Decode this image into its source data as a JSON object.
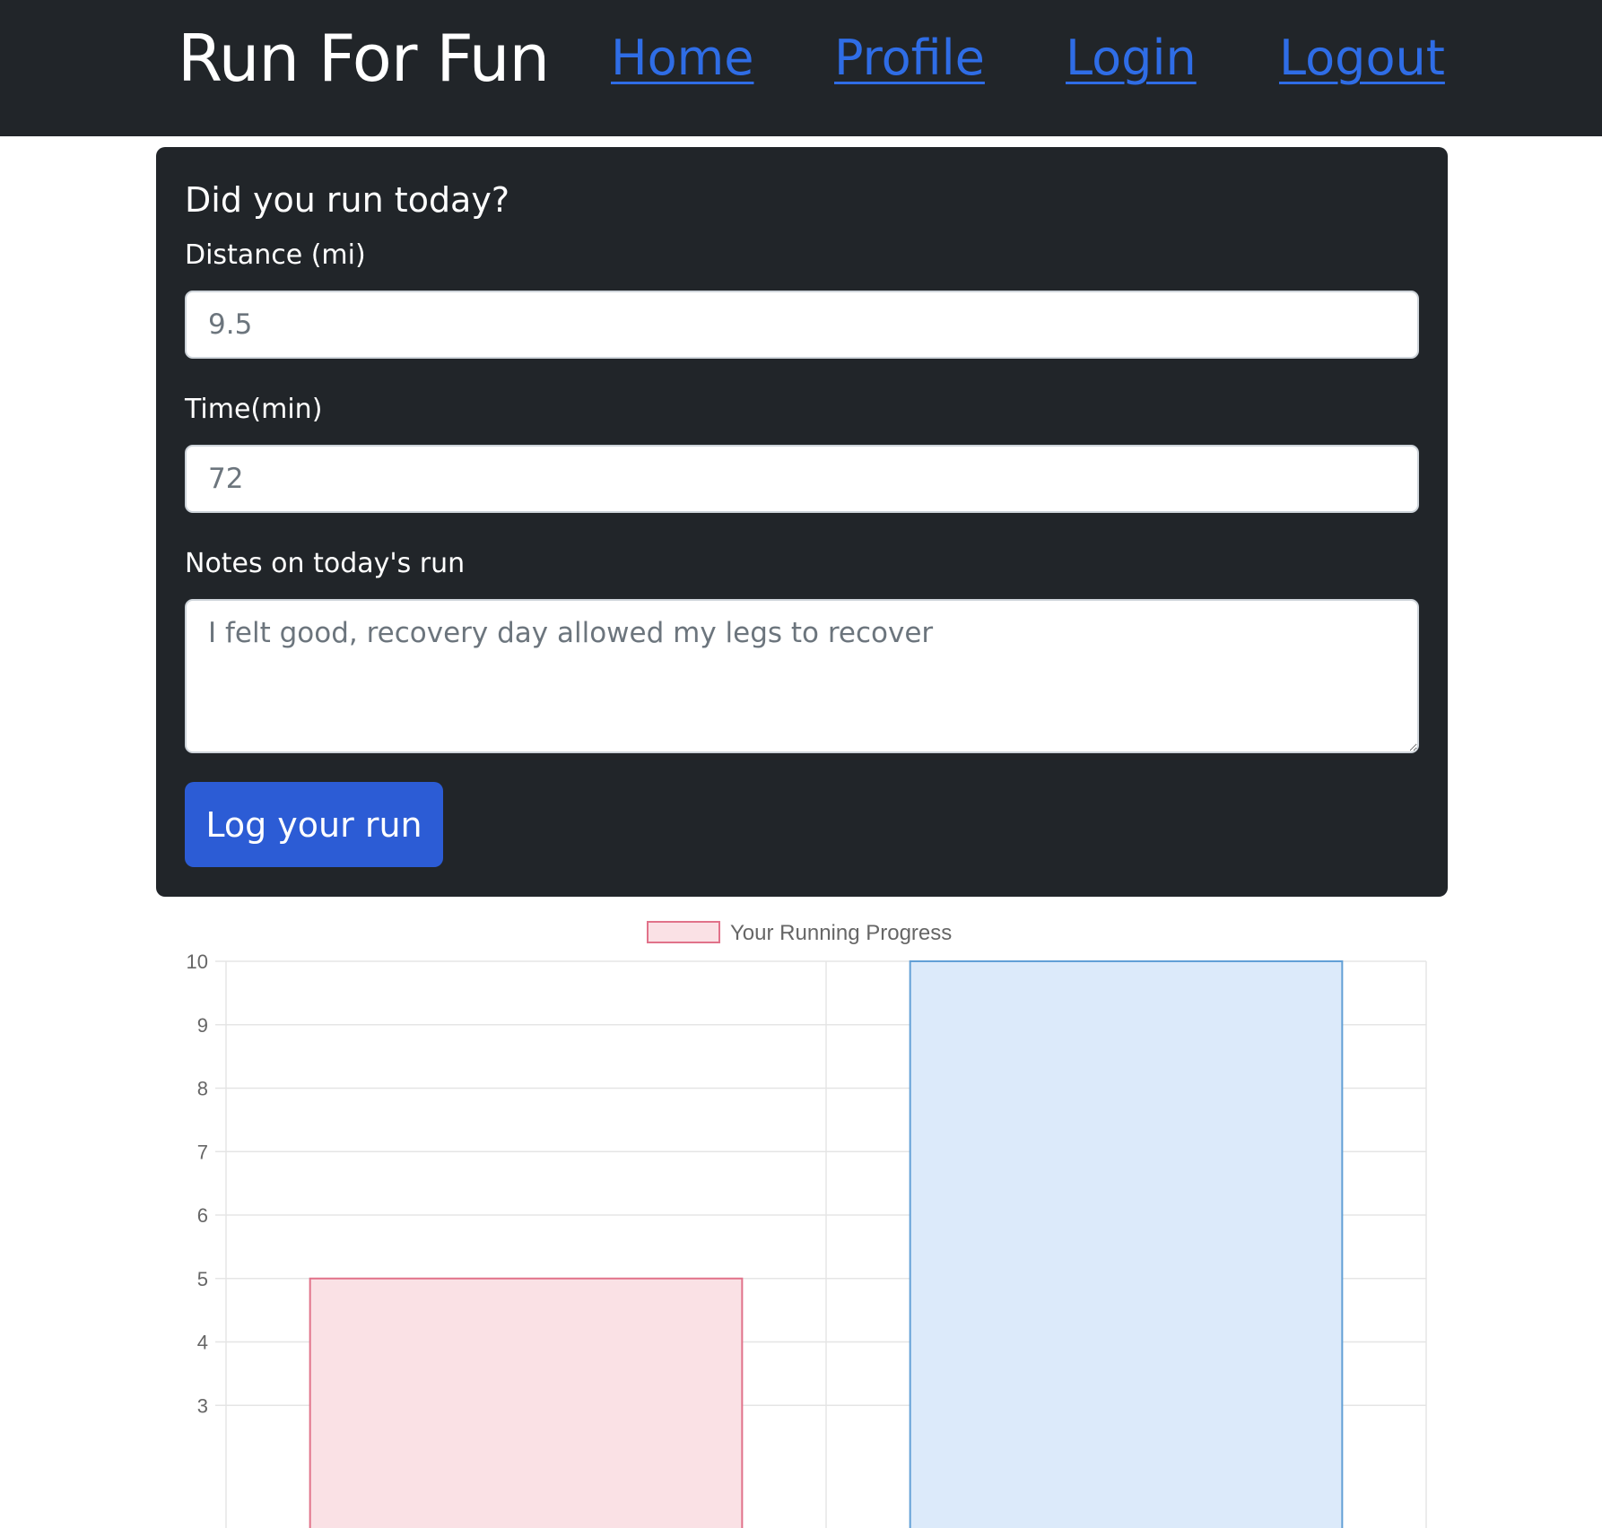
{
  "navbar": {
    "brand": "Run For Fun",
    "links": [
      {
        "label": "Home"
      },
      {
        "label": "Profile"
      },
      {
        "label": "Login"
      },
      {
        "label": "Logout"
      }
    ]
  },
  "form": {
    "title": "Did you run today?",
    "distance": {
      "label": "Distance (mi)",
      "placeholder": "9.5"
    },
    "time": {
      "label": "Time(min)",
      "placeholder": "72"
    },
    "notes": {
      "label": "Notes on today's run",
      "placeholder": "I felt good, recovery day allowed my legs to recover"
    },
    "submit_label": "Log your run"
  },
  "colors": {
    "navbar_bg": "#212529",
    "link": "#2f6de6",
    "button": "#2c5cd5",
    "bar1_fill": "#fae1e5",
    "bar1_border": "#e1728a",
    "bar2_fill": "#dceafa",
    "bar2_border": "#62a0d6"
  },
  "chart_data": {
    "type": "bar",
    "legend": {
      "label": "Your Running Progress",
      "position": "top"
    },
    "series": [
      {
        "name": "Your Running Progress",
        "values": [
          5,
          10
        ]
      }
    ],
    "ylim": [
      3,
      10
    ],
    "yticks": [
      "10",
      "9",
      "8",
      "7",
      "6",
      "5",
      "4",
      "3"
    ],
    "grid": true,
    "bar_colors": [
      {
        "fill": "#fae1e5",
        "border": "#e1728a"
      },
      {
        "fill": "#dceafa",
        "border": "#62a0d6"
      }
    ]
  }
}
